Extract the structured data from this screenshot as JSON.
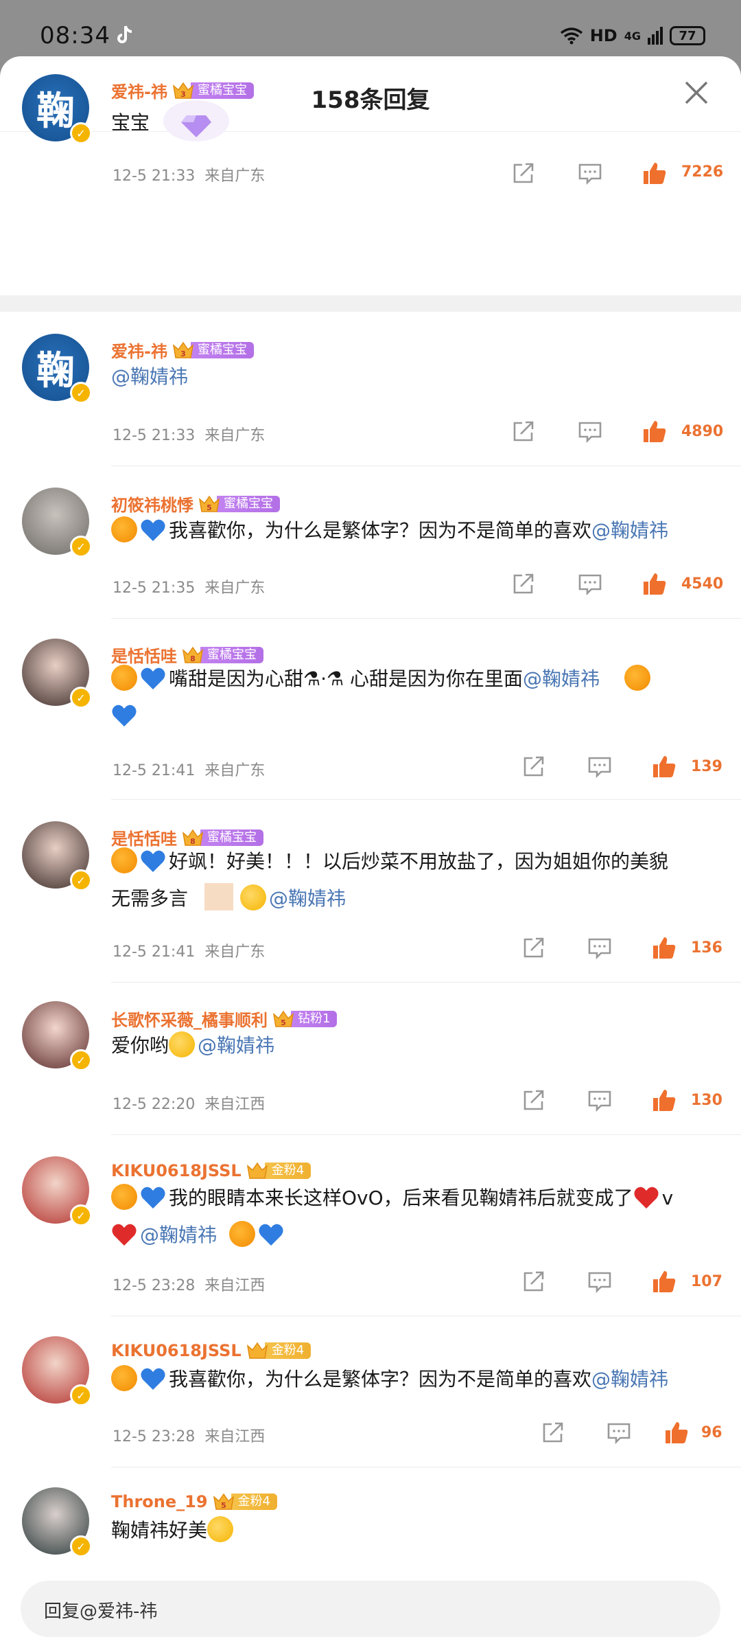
{
  "status": {
    "time": "08:34",
    "network": "HD",
    "signal": "4G",
    "battery": "77"
  },
  "header": {
    "title": "158条回复"
  },
  "comments": [
    {
      "user": "爱祎-祎",
      "badge_level": "3",
      "badge": "蜜橘宝宝",
      "text": "宝宝",
      "time": "12-5  21:33",
      "location": "来自广东",
      "likes": "7226"
    },
    {
      "user": "爱祎-祎",
      "badge_level": "3",
      "badge": "蜜橘宝宝",
      "mention": "@鞠婧祎",
      "time": "12-5  21:33",
      "location": "来自广东",
      "likes": "4890"
    },
    {
      "user": "初筱祎桃悸",
      "badge_level": "5",
      "badge": "蜜橘宝宝",
      "text": "我喜歡你，为什么是繁体字？因为不是简单的喜欢",
      "mention": "@鞠婧祎",
      "time": "12-5  21:35",
      "location": "来自广东",
      "likes": "4540"
    },
    {
      "user": "是恬恬哇",
      "badge_level": "8",
      "badge": "蜜橘宝宝",
      "text": "嘴甜是因为心甜⚗·⚗ 心甜是因为你在里面",
      "mention": "@鞠婧祎",
      "time": "12-5  21:41",
      "location": "来自广东",
      "likes": "139"
    },
    {
      "user": "是恬恬哇",
      "badge_level": "8",
      "badge": "蜜橘宝宝",
      "text": "好飒！好美！！！以后炒菜不用放盐了，因为姐姐你的美貌",
      "text2": "无需多言",
      "mention": "@鞠婧祎",
      "time": "12-5  21:41",
      "location": "来自广东",
      "likes": "136"
    },
    {
      "user": "长歌怀采薇_橘事顺利",
      "badge_level": "5",
      "badge": "钻粉1",
      "text": "爱你哟",
      "mention": "@鞠婧祎",
      "time": "12-5  22:20",
      "location": "来自江西",
      "likes": "130"
    },
    {
      "user": "KIKU0618JSSL",
      "badge_level": "",
      "badge": "金粉4",
      "text": "我的眼睛本来长这样OvO，后来看见鞠婧祎后就变成了",
      "text_v": "v",
      "mention": "@鞠婧祎",
      "time": "12-5  23:28",
      "location": "来自江西",
      "likes": "107"
    },
    {
      "user": "KIKU0618JSSL",
      "badge_level": "",
      "badge": "金粉4",
      "text": "我喜歡你，为什么是繁体字？因为不是简单的喜欢",
      "mention": "@鞠婧祎",
      "time": "12-5  23:28",
      "location": "来自江西",
      "likes": "96"
    },
    {
      "user": "Throne_19",
      "badge_level": "5",
      "badge": "金粉4",
      "text": "鞠婧祎好美"
    }
  ],
  "avatar_char": "鞠",
  "reply": {
    "placeholder": "回复@爱祎-祎"
  },
  "colors": {
    "accent": "#eb7231",
    "mention": "#4a77b4"
  }
}
